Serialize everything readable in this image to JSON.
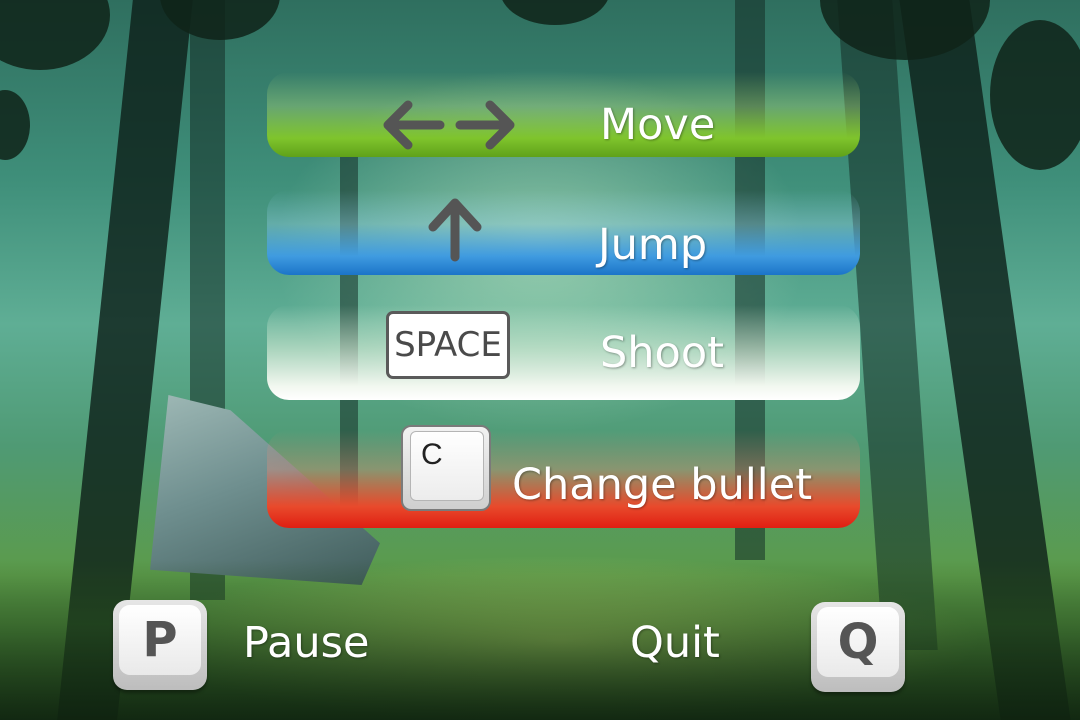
{
  "controls": {
    "move": {
      "label": "Move",
      "icon": "left-right-arrows-icon",
      "band_color": "#6ab521"
    },
    "jump": {
      "label": "Jump",
      "icon": "up-arrow-icon",
      "band_color": "#2a88d8"
    },
    "shoot": {
      "label": "Shoot",
      "key": "SPACE",
      "band_color": "#ffffff"
    },
    "change_bullet": {
      "label": "Change bullet",
      "key": "C",
      "band_color": "#e42a18"
    }
  },
  "bottom": {
    "pause": {
      "label": "Pause",
      "key": "P"
    },
    "quit": {
      "label": "Quit",
      "key": "Q"
    }
  }
}
